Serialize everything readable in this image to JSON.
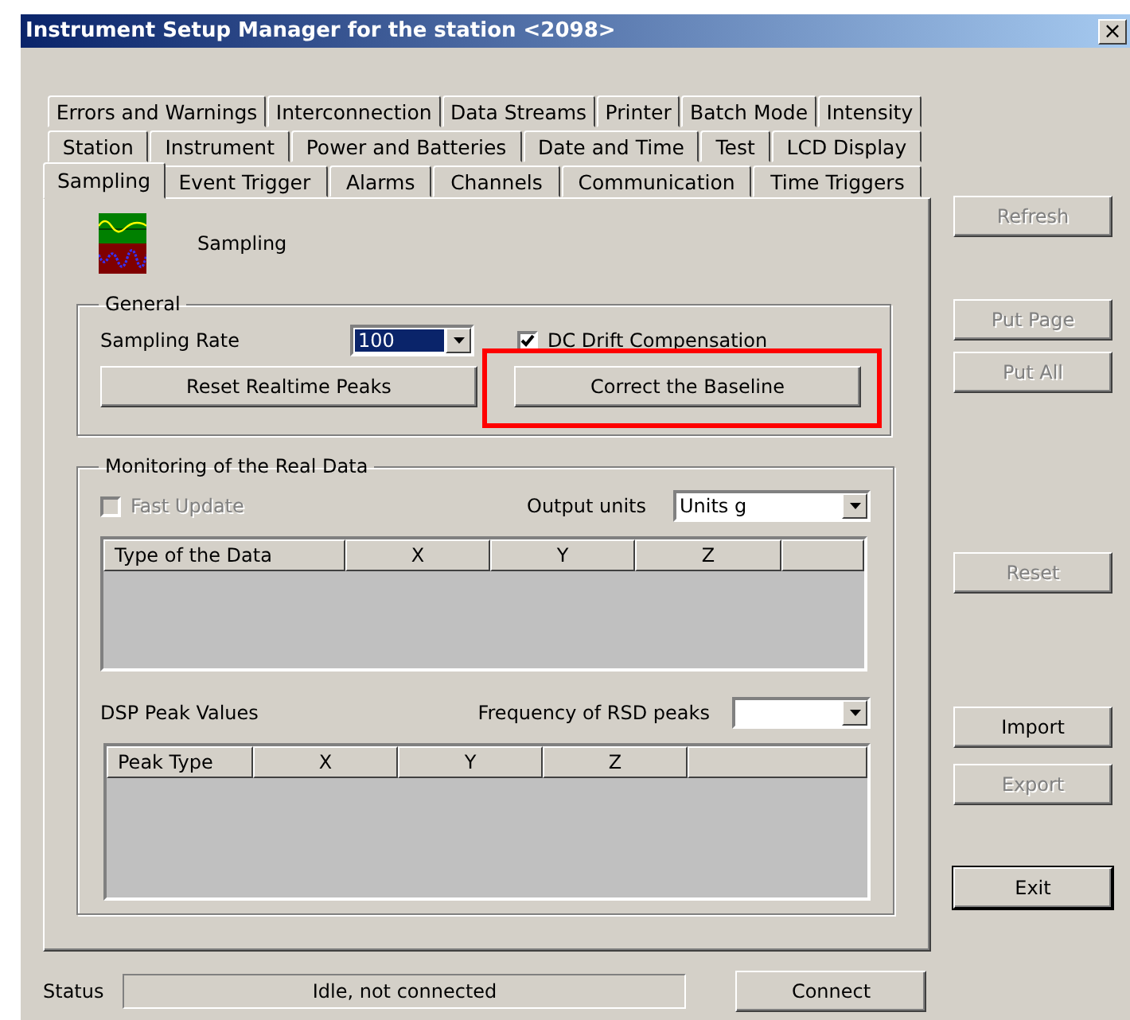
{
  "window": {
    "title": "Instrument Setup Manager for the station <2098>",
    "close": "×"
  },
  "tab_rows": [
    {
      "tabs": [
        {
          "label": "Errors and Warnings",
          "selected": false
        },
        {
          "label": "Interconnection",
          "selected": false
        },
        {
          "label": "Data Streams",
          "selected": false
        },
        {
          "label": "Printer",
          "selected": false
        },
        {
          "label": "Batch Mode",
          "selected": false
        },
        {
          "label": "Intensity",
          "selected": false
        }
      ]
    },
    {
      "tabs": [
        {
          "label": "Station",
          "selected": false
        },
        {
          "label": "Instrument",
          "selected": false
        },
        {
          "label": "Power and Batteries",
          "selected": false
        },
        {
          "label": "Date and Time",
          "selected": false
        },
        {
          "label": "Test",
          "selected": false
        },
        {
          "label": "LCD Display",
          "selected": false
        }
      ]
    },
    {
      "tabs": [
        {
          "label": "Sampling",
          "selected": true
        },
        {
          "label": "Event Trigger",
          "selected": false
        },
        {
          "label": "Alarms",
          "selected": false
        },
        {
          "label": "Channels",
          "selected": false
        },
        {
          "label": "Communication",
          "selected": false
        },
        {
          "label": "Time Triggers",
          "selected": false
        }
      ]
    }
  ],
  "page": {
    "title": "Sampling"
  },
  "general": {
    "title": "General",
    "sampling_rate": {
      "label": "Sampling Rate",
      "value": "100"
    },
    "dc_drift": {
      "label": "DC Drift Compensation",
      "checked": true
    },
    "buttons": [
      {
        "label": "Reset Realtime Peaks",
        "highlighted": false
      },
      {
        "label": "Correct the Baseline",
        "highlighted": true
      }
    ]
  },
  "monitoring": {
    "title": "Monitoring of the Real Data",
    "fast_update": {
      "label": "Fast Update",
      "checked": false,
      "disabled": true
    },
    "output_units": {
      "label": "Output units",
      "value": "Units g"
    },
    "data_table": {
      "columns": [
        "Type of the Data",
        "X",
        "Y",
        "Z"
      ]
    },
    "dsp_label": "DSP Peak Values",
    "rsd_frequency": {
      "label": "Frequency of RSD peaks"
    },
    "peak_table": {
      "columns": [
        "Peak Type",
        "X",
        "Y",
        "Z"
      ]
    }
  },
  "side_buttons": [
    {
      "label": "Refresh",
      "disabled": true,
      "default": false
    },
    {
      "label": "Put Page",
      "disabled": true,
      "default": false
    },
    {
      "label": "Put All",
      "disabled": true,
      "default": false
    },
    {
      "label": "Reset",
      "disabled": true,
      "default": false
    },
    {
      "label": "Import",
      "disabled": false,
      "default": false
    },
    {
      "label": "Export",
      "disabled": true,
      "default": false
    },
    {
      "label": "Exit",
      "disabled": false,
      "default": true
    }
  ],
  "status_bar": {
    "label": "Status",
    "value": "Idle, not connected",
    "button": "Connect"
  }
}
